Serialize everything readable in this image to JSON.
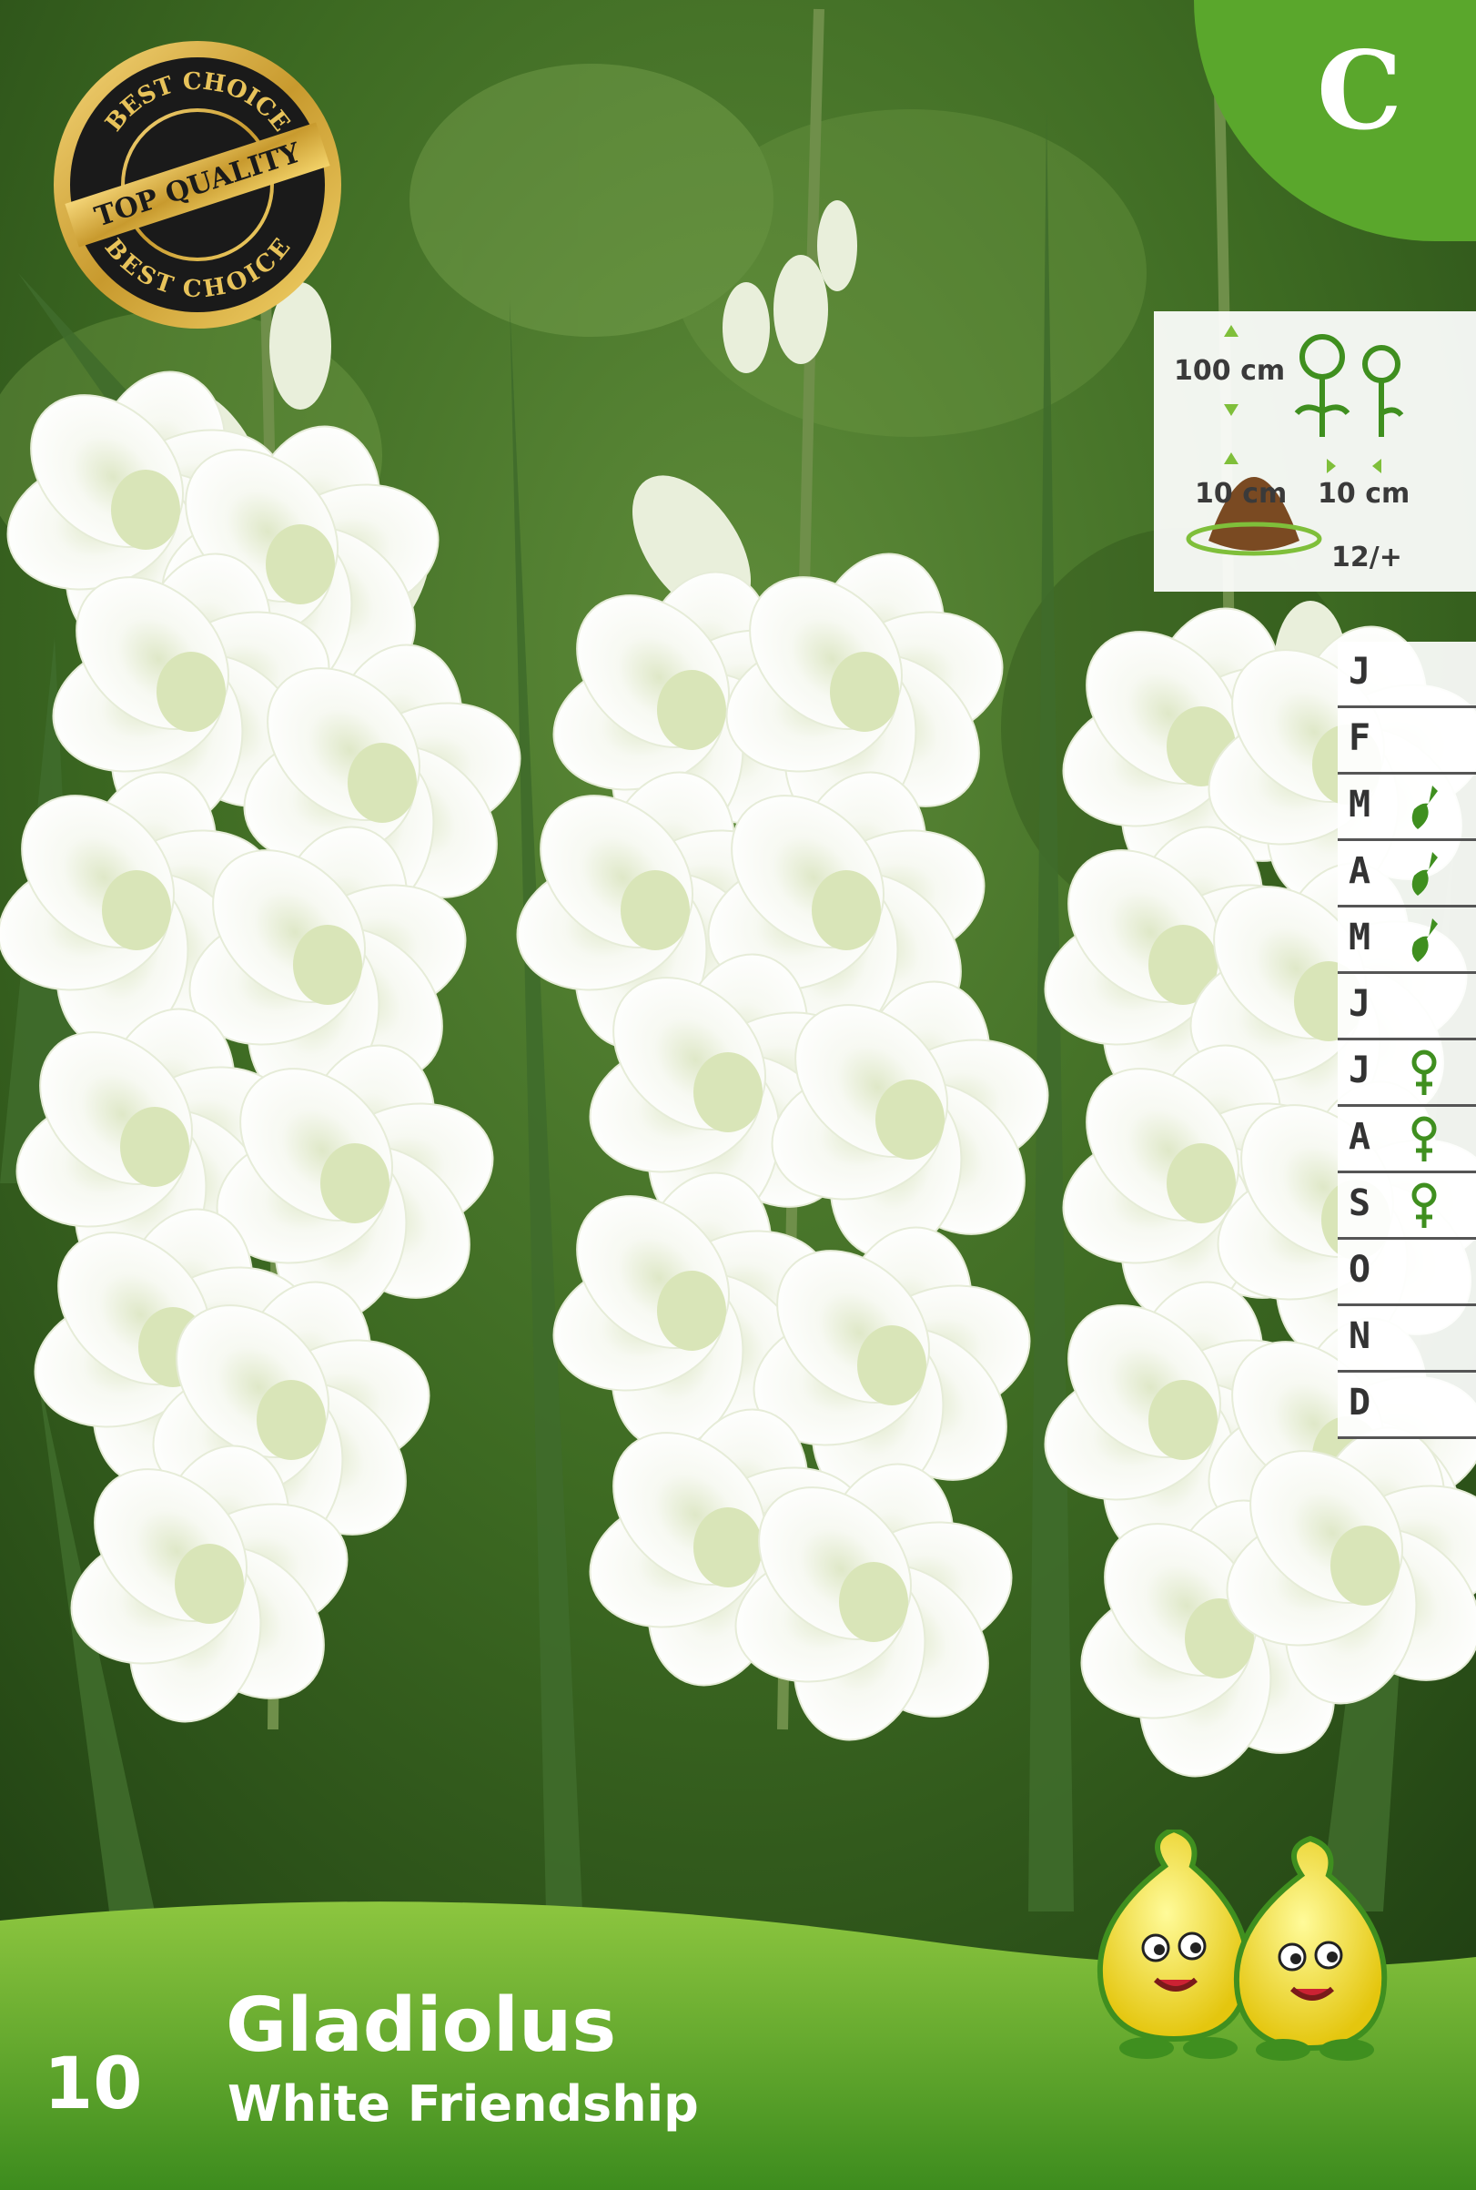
{
  "seal": {
    "top_text": "BEST CHOICE",
    "center_text": "TOP QUALITY",
    "bottom_text": "BEST CHOICE"
  },
  "category_badge": "C",
  "specs": {
    "height": "100 cm",
    "depth": "10 cm",
    "spacing": "10 cm",
    "bulb_size": "12/+"
  },
  "calendar": [
    {
      "letter": "J",
      "icon": ""
    },
    {
      "letter": "F",
      "icon": ""
    },
    {
      "letter": "M",
      "icon": "trowel-icon"
    },
    {
      "letter": "A",
      "icon": "trowel-icon"
    },
    {
      "letter": "M",
      "icon": "trowel-icon"
    },
    {
      "letter": "J",
      "icon": ""
    },
    {
      "letter": "J",
      "icon": "flower-icon"
    },
    {
      "letter": "A",
      "icon": "flower-icon"
    },
    {
      "letter": "S",
      "icon": "flower-icon"
    },
    {
      "letter": "O",
      "icon": ""
    },
    {
      "letter": "N",
      "icon": ""
    },
    {
      "letter": "D",
      "icon": ""
    }
  ],
  "product": {
    "count": "10",
    "name": "Gladiolus",
    "variety": "White Friendship"
  },
  "colors": {
    "accent_green": "#5aa72c",
    "icon_green": "#3f8f1f"
  }
}
